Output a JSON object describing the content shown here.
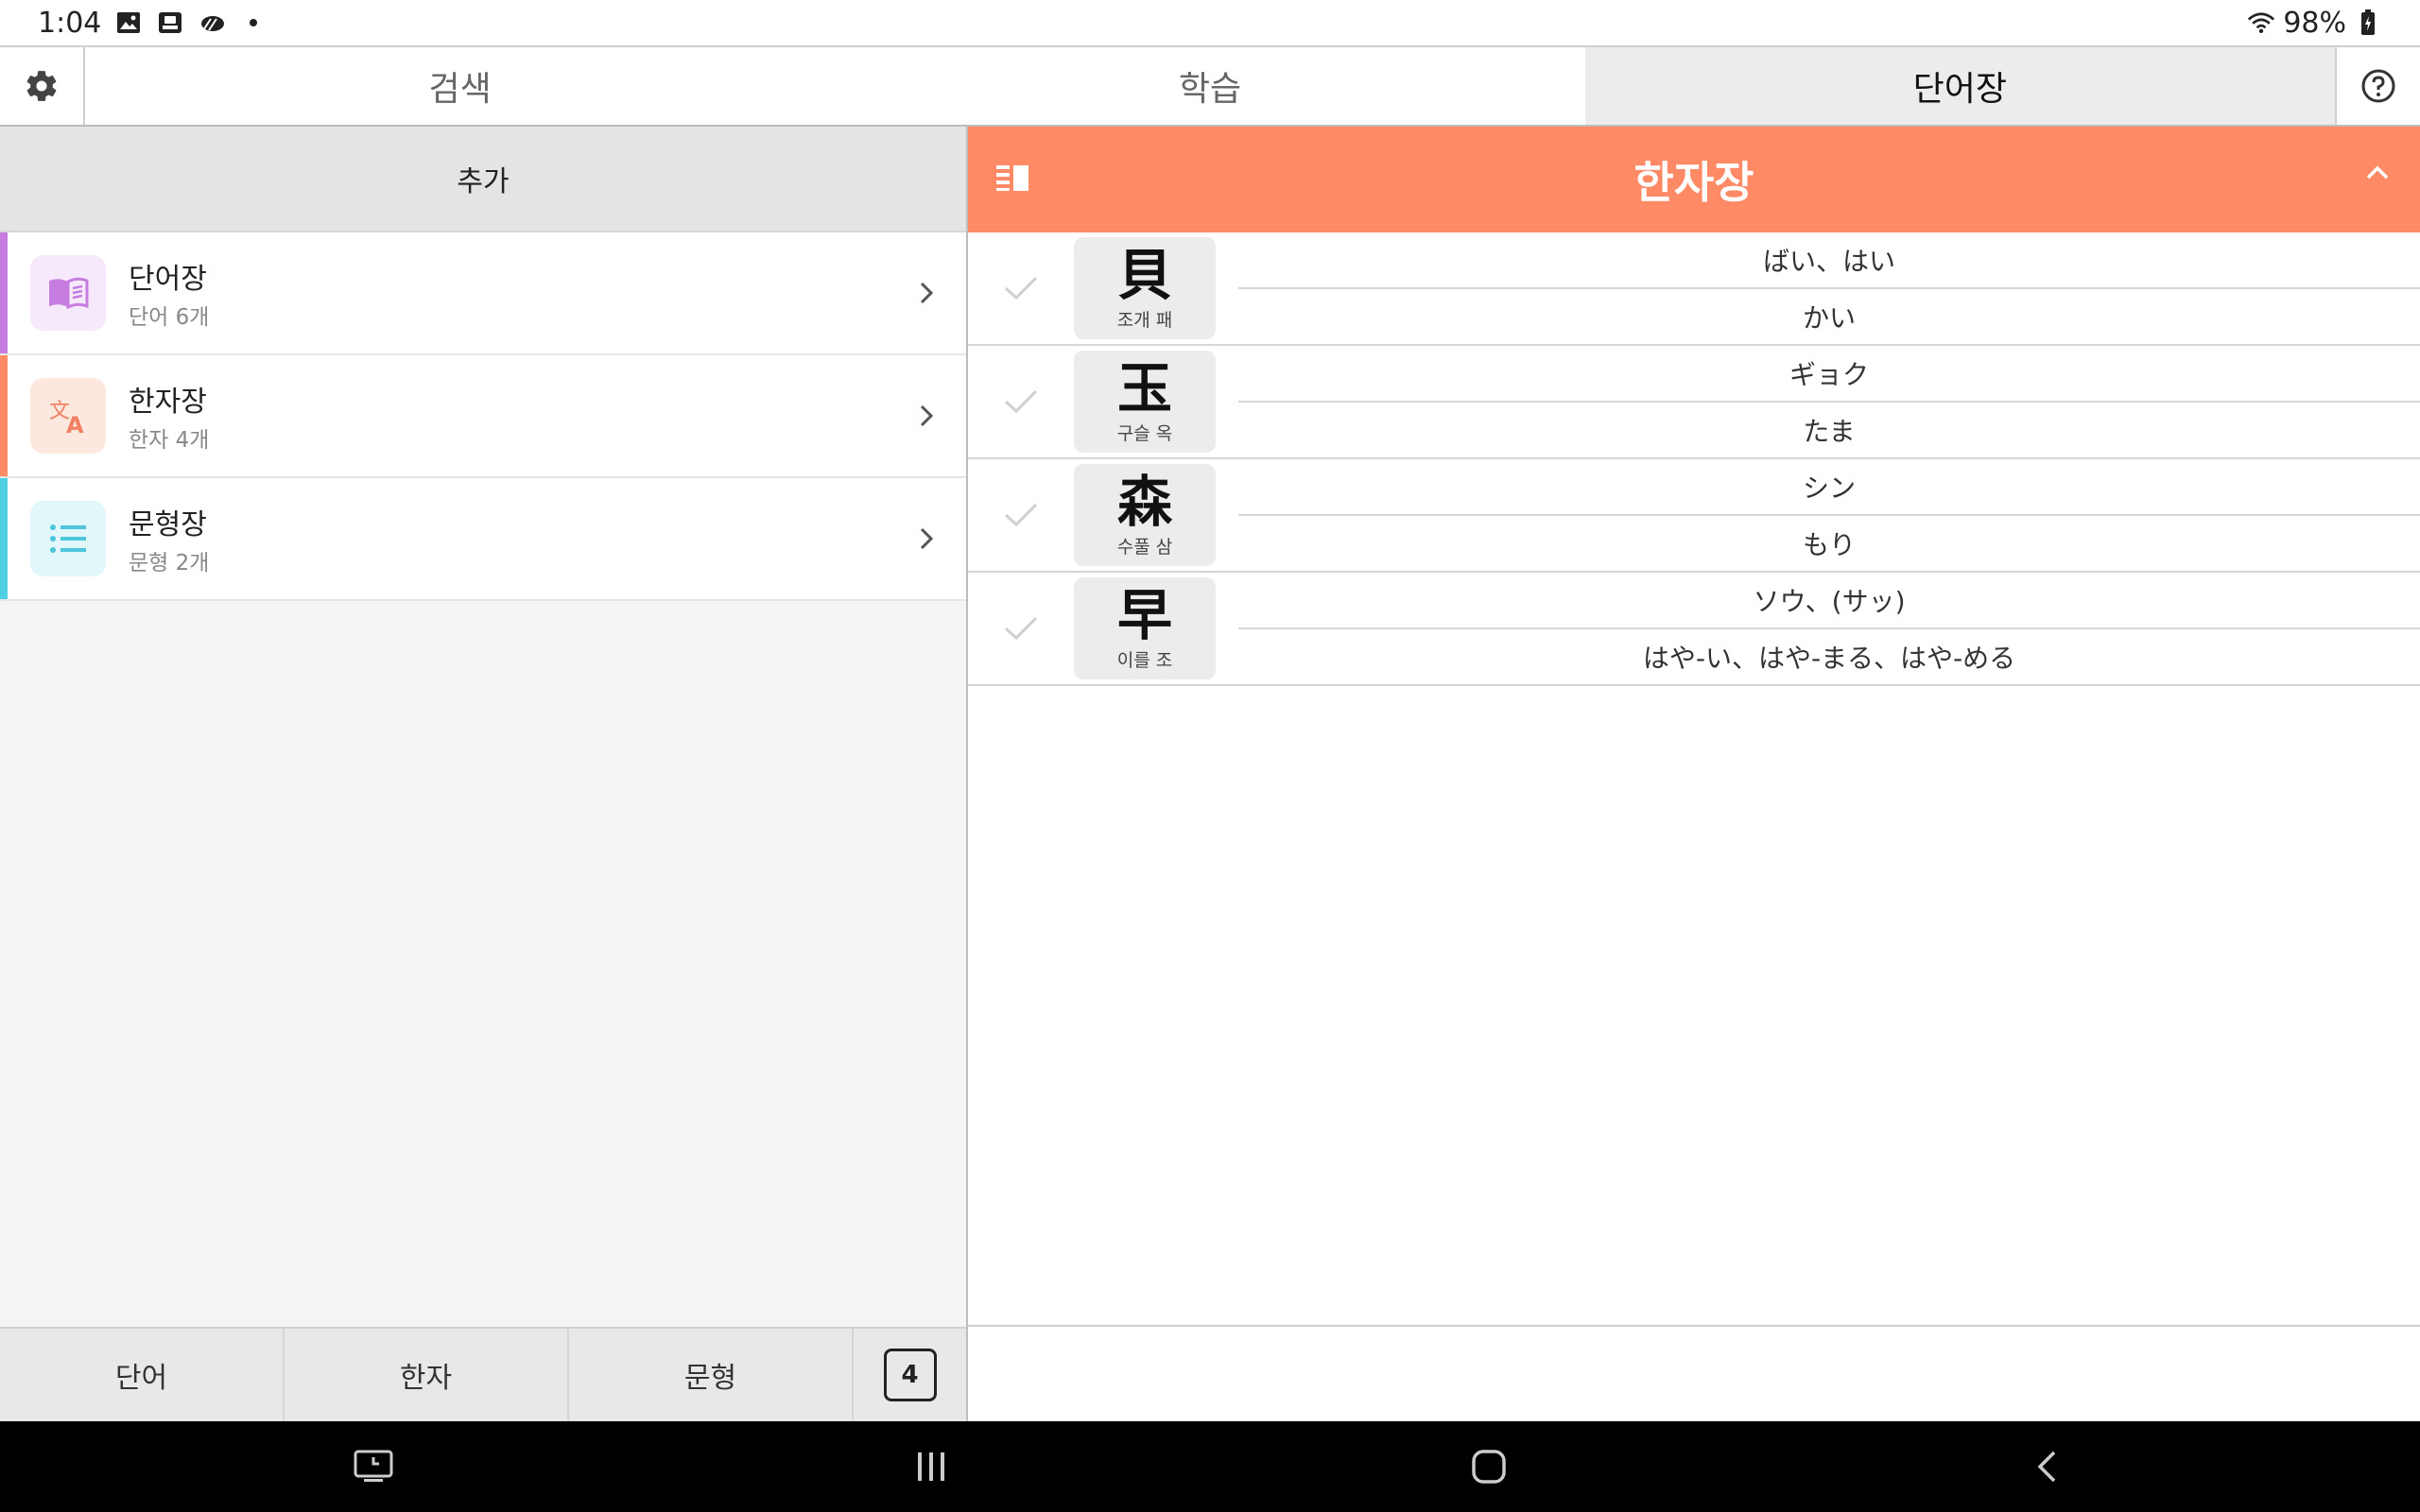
{
  "status": {
    "time": "1:04",
    "battery": "98%"
  },
  "tabs": [
    {
      "label": "검색"
    },
    {
      "label": "학습"
    },
    {
      "label": "단어장"
    }
  ],
  "left": {
    "add_label": "추가",
    "items": [
      {
        "title": "단어장",
        "sub": "단어 6개",
        "accent": "#c77de0",
        "icon": "book-icon"
      },
      {
        "title": "한자장",
        "sub": "한자 4개",
        "accent": "#ff8a65",
        "icon": "translate-icon"
      },
      {
        "title": "문형장",
        "sub": "문형 2개",
        "accent": "#4dd0e1",
        "icon": "list-icon"
      }
    ],
    "bottom_tabs": [
      {
        "label": "단어"
      },
      {
        "label": "한자"
      },
      {
        "label": "문형"
      }
    ],
    "count": "4"
  },
  "right": {
    "title": "한자장",
    "header_color": "#ff8a65",
    "rows": [
      {
        "kanji": "貝",
        "meaning": "조개 패",
        "on": "ばい、はい",
        "kun": "かい"
      },
      {
        "kanji": "玉",
        "meaning": "구슬 옥",
        "on": "ギョク",
        "kun": "たま"
      },
      {
        "kanji": "森",
        "meaning": "수풀 삼",
        "on": "シン",
        "kun": "もり"
      },
      {
        "kanji": "早",
        "meaning": "이를 조",
        "on": "ソウ、(サッ)",
        "kun": "はや-い、はや-まる、はや-める"
      }
    ]
  }
}
